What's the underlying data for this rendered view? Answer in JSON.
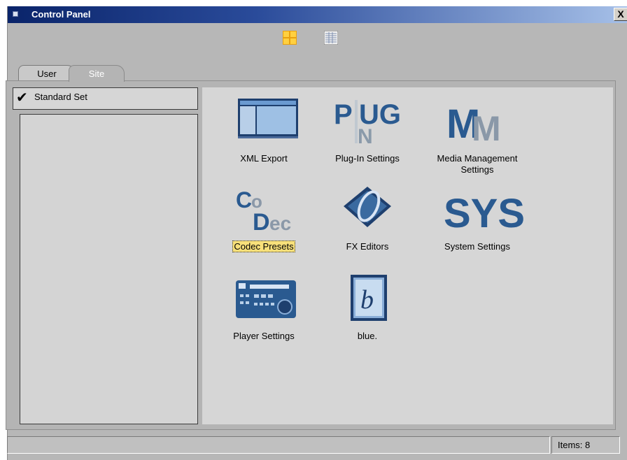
{
  "window": {
    "title": "Control Panel",
    "close_label": "X"
  },
  "toolbar": {
    "large_icons_icon": "large-icons-view-icon",
    "list_icon": "list-view-icon"
  },
  "tabs": [
    {
      "label": "User",
      "active": false
    },
    {
      "label": "Site",
      "active": true
    }
  ],
  "selector": {
    "value": "Standard Set",
    "checked": true
  },
  "items": [
    {
      "label": "XML Export",
      "icon": "xml-export-icon"
    },
    {
      "label": "Plug-In Settings",
      "icon": "plug-in-icon"
    },
    {
      "label": "Media Management Settings",
      "icon": "media-management-icon"
    },
    {
      "label": "Codec Presets",
      "icon": "codec-icon",
      "selected": true
    },
    {
      "label": "FX Editors",
      "icon": "fx-editors-icon"
    },
    {
      "label": "System Settings",
      "icon": "system-settings-icon"
    },
    {
      "label": "Player Settings",
      "icon": "player-settings-icon"
    },
    {
      "label": "blue.",
      "icon": "blue-icon"
    }
  ],
  "status": {
    "items_count": "Items: 8"
  },
  "colors": {
    "titlebar_start": "#0a246a",
    "titlebar_end": "#a6c0e8",
    "selection_highlight": "#f8e07a",
    "window_bg": "#b7b7b7",
    "pane_bg": "#d6d6d6"
  }
}
